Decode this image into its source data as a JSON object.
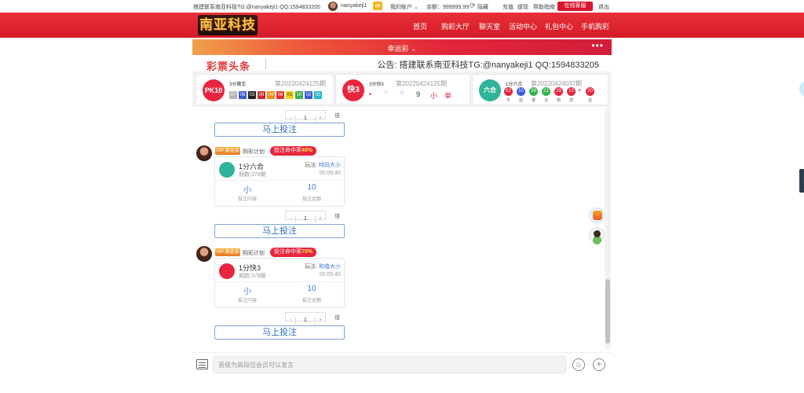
{
  "topbar": {
    "contact": "搭建联系南亚科技TG:@nanyakeji1 QQ:1594833205",
    "username": "nanyakeji1",
    "my_account": "我的账户",
    "balance": "余额：999999.99",
    "hide": "隐藏",
    "deposit": "充值",
    "withdraw": "提现",
    "help": "帮助指南",
    "customer_service": "在线客服",
    "logout": "退出"
  },
  "logo": "南亚科技",
  "nav": [
    "首页",
    "购彩大厅",
    "聊天室",
    "活动中心",
    "礼包中心",
    "手机购彩"
  ],
  "lucky_bar": {
    "label": "幸运彩",
    "more": "•••"
  },
  "headline": {
    "brand": "彩票头条",
    "notice": "公告: 搭建联系南亚科技TG:@nanyakeji1 QQ:1594833205"
  },
  "lotteries": [
    {
      "icon_text": "PK10",
      "name": "3分赛车",
      "issue": "第20220424125期",
      "numbers": [
        "07",
        "06",
        "03",
        "09",
        "04",
        "08",
        "01",
        "10",
        "02",
        "05"
      ]
    },
    {
      "icon_text": "快3",
      "name": "3分快3",
      "issue": "第20220424125期",
      "sum": "9",
      "size": "小",
      "parity": "单"
    },
    {
      "icon_text": "六合",
      "name": "1分六合",
      "issue": "第20220424037期",
      "numbers": [
        "02",
        "10",
        "39",
        "21",
        "29",
        "13",
        "20"
      ],
      "zodiac": [
        "牛",
        "鼠",
        "猴",
        "马",
        "狗",
        "虎",
        "鼠"
      ]
    }
  ],
  "chat": {
    "first_stepper": {
      "value": "1",
      "bei": "倍",
      "button": "马上投注"
    },
    "messages": [
      {
        "vip": "VIP 黄金会",
        "plan": "购彩计划",
        "hit_label": "投注命中率",
        "hit_rate": "40%",
        "lottery": "1分六合",
        "issue": "期数:378期",
        "play_label": "玩法:",
        "play": "特码大小",
        "time": "00:00:40",
        "bet_content": "小",
        "bet_content_label": "投注内容",
        "bet_amount": "10",
        "bet_amount_label": "投注金额",
        "stepper_value": "1",
        "bei": "倍",
        "button": "马上投注"
      },
      {
        "vip": "VIP 黄金会",
        "plan": "购彩计划",
        "hit_label": "投注命中率",
        "hit_rate": "70%",
        "lottery": "1分快3",
        "issue": "期数:378期",
        "play_label": "玩法:",
        "play": "和值大小",
        "time": "00:00:40",
        "bet_content": "小",
        "bet_content_label": "投注内容",
        "bet_amount": "10",
        "bet_amount_label": "投注金额",
        "stepper_value": "1",
        "bei": "倍",
        "button": "马上投注"
      }
    ]
  },
  "input": {
    "placeholder": "晋级为高段位会员可以发言"
  },
  "colors": {
    "brand_red": "#d41b27",
    "accent_blue": "#3a7bd5",
    "hit_red": "#e8253e"
  }
}
